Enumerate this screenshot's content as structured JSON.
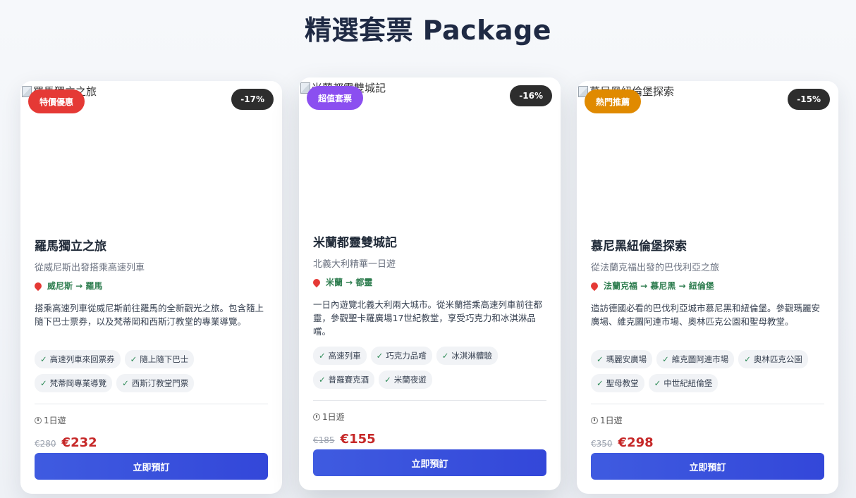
{
  "page": {
    "title": "精選套票 Package"
  },
  "cards": [
    {
      "image_alt": "羅馬獨立之旅",
      "badge": "特價優惠",
      "badge_color": "#e53935",
      "discount": "-17%",
      "name": "羅馬獨立之旅",
      "subtitle": "從威尼斯出發搭乘高速列車",
      "route": "威尼斯 → 羅馬",
      "description": "搭乘高速列車從威尼斯前往羅馬的全新觀光之旅。包含隨上隨下巴士票券，以及梵蒂岡和西斯汀教堂的專業導覽。",
      "tags": [
        "高速列車來回票券",
        "隨上隨下巴士",
        "梵蒂岡專業導覽",
        "西斯汀教堂門票"
      ],
      "duration": "1日遊",
      "old_price": "€280",
      "new_price": "€232",
      "button": "立即預訂"
    },
    {
      "image_alt": "米蘭都靈雙城記",
      "badge": "超值套票",
      "badge_color": "#8b4ff0",
      "discount": "-16%",
      "name": "米蘭都靈雙城記",
      "subtitle": "北義大利精華一日遊",
      "route": "米蘭 → 都靈",
      "description": "一日內遊覽北義大利兩大城市。從米蘭搭乘高速列車前往都靈，參觀聖卡羅廣場17世紀教堂，享受巧克力和冰淇淋品嚐。",
      "tags": [
        "高速列車",
        "巧克力品嚐",
        "冰淇淋體驗",
        "普羅賽克酒",
        "米蘭夜遊"
      ],
      "duration": "1日遊",
      "old_price": "€185",
      "new_price": "€155",
      "button": "立即預訂"
    },
    {
      "image_alt": "慕尼黑紐倫堡探索",
      "badge": "熱門推薦",
      "badge_color": "#e08a00",
      "discount": "-15%",
      "name": "慕尼黑紐倫堡探索",
      "subtitle": "從法蘭克福出發的巴伐利亞之旅",
      "route": "法蘭克福 → 慕尼黑 → 紐倫堡",
      "description": "造訪德國必看的巴伐利亞城市慕尼黑和紐倫堡。參觀瑪麗安廣場、維克圖阿連市場、奧林匹克公園和聖母教堂。",
      "tags": [
        "瑪麗安廣場",
        "維克圖阿連市場",
        "奧林匹克公園",
        "聖母教堂",
        "中世紀紐倫堡"
      ],
      "duration": "1日遊",
      "old_price": "€350",
      "new_price": "€298",
      "button": "立即預訂"
    }
  ]
}
